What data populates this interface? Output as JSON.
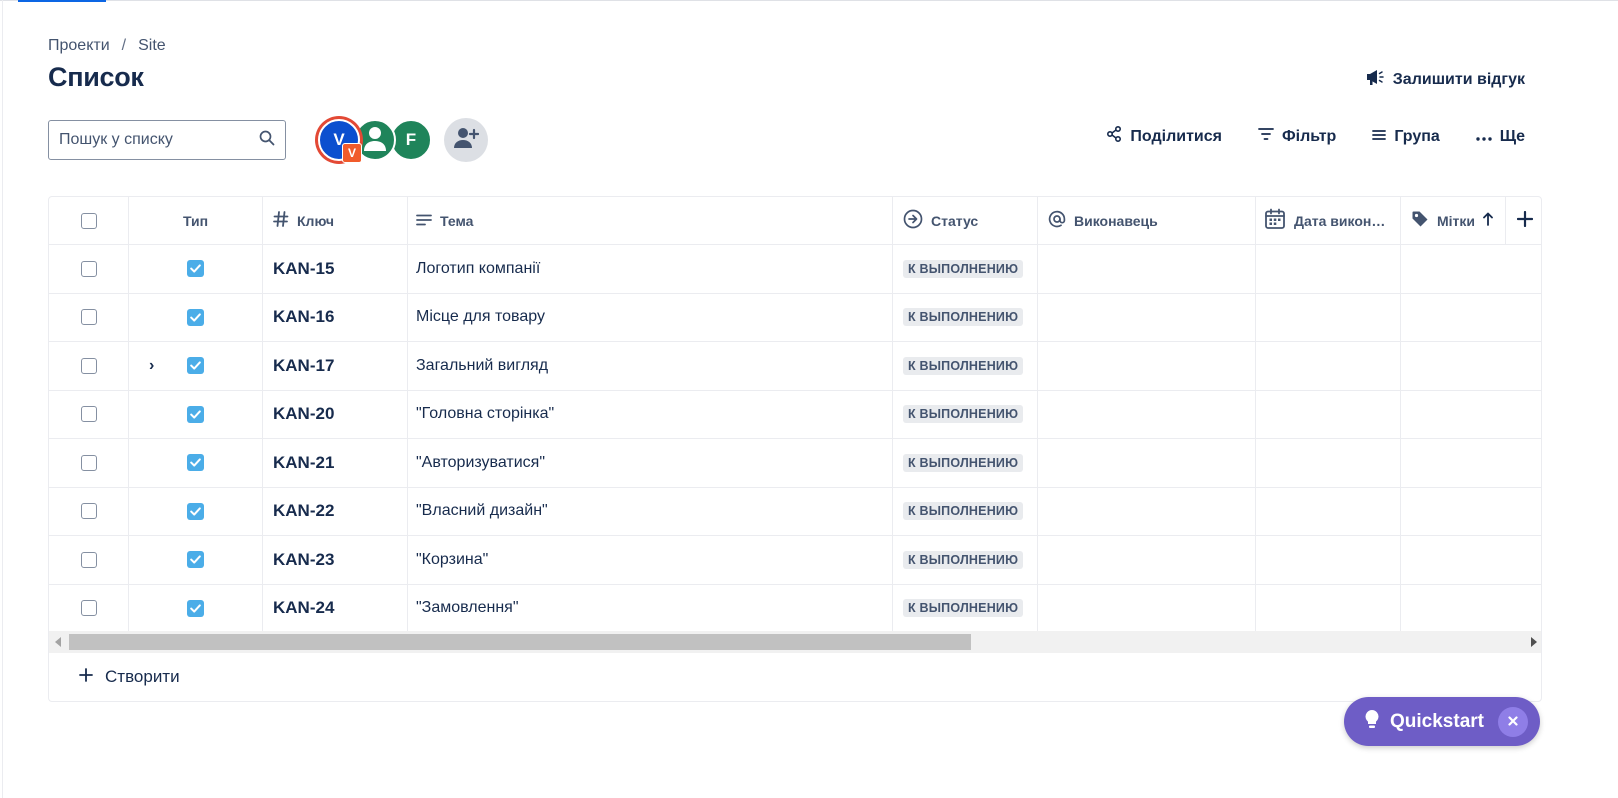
{
  "breadcrumb": {
    "parent": "Проекти",
    "separator": "/",
    "current": "Site"
  },
  "page": {
    "title": "Список"
  },
  "feedback": {
    "label": "Залишити відгук"
  },
  "search": {
    "placeholder": "Пошук у списку"
  },
  "avatars": [
    {
      "initial": "V",
      "sub_initial": "V"
    },
    {
      "initial": ""
    },
    {
      "initial": "F"
    }
  ],
  "toolbar": {
    "share_label": "Поділитися",
    "filter_label": "Фільтр",
    "group_label": "Група",
    "more_label": "Ще"
  },
  "table": {
    "columns": {
      "type": "Тип",
      "key": "Ключ",
      "summary": "Тема",
      "status": "Статус",
      "assignee": "Виконавець",
      "due_date": "Дата викон…",
      "labels": "Мітки"
    },
    "rows": [
      {
        "key": "KAN-15",
        "summary": "Логотип компанії",
        "status": "К ВЫПОЛНЕНИЮ"
      },
      {
        "key": "KAN-16",
        "summary": "Місце для товару",
        "status": "К ВЫПОЛНЕНИЮ"
      },
      {
        "key": "KAN-17",
        "summary": "Загальний вигляд",
        "status": "К ВЫПОЛНЕНИЮ"
      },
      {
        "key": "KAN-20",
        "summary": "\"Головна сторінка\"",
        "status": "К ВЫПОЛНЕНИЮ"
      },
      {
        "key": "KAN-21",
        "summary": "\"Авторизуватися\"",
        "status": "К ВЫПОЛНЕНИЮ"
      },
      {
        "key": "KAN-22",
        "summary": "\"Власний дизайн\"",
        "status": "К ВЫПОЛНЕНИЮ"
      },
      {
        "key": "KAN-23",
        "summary": "\"Корзина\"",
        "status": "К ВЫПОЛНЕНИЮ"
      },
      {
        "key": "KAN-24",
        "summary": "\"Замовлення\"",
        "status": "К ВЫПОЛНЕНИЮ"
      }
    ],
    "scroll_position": 0.0
  },
  "create": {
    "label": "Створити"
  },
  "quickstart": {
    "label": "Quickstart"
  },
  "colors": {
    "accent": "#0c66e4",
    "task": "#4bade8",
    "quickstart": "#6e5dc6"
  }
}
